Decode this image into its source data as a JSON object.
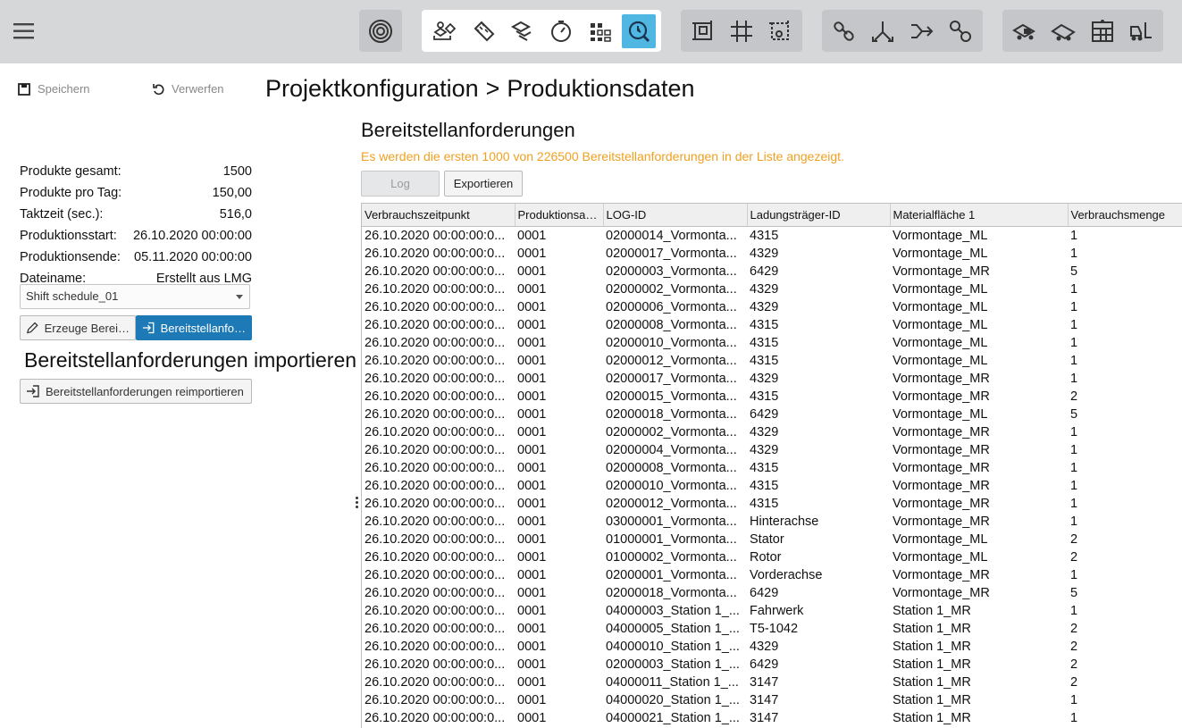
{
  "toolbar": {
    "menu_icon": "hamburger-icon",
    "groups": [
      {
        "buttons": [
          "radar-icon"
        ]
      },
      {
        "buttons": [
          "parts-icon",
          "ruler-icon",
          "layers-icon",
          "stopwatch-icon",
          "matrix-icon",
          "schedule-search-icon"
        ],
        "active": "schedule-search-icon"
      },
      {
        "buttons": [
          "frame-icon",
          "grid-icon",
          "area-icon"
        ]
      },
      {
        "buttons": [
          "chain-icon",
          "split-icon",
          "merge-icon",
          "link-icon"
        ]
      },
      {
        "buttons": [
          "truck-loading-icon",
          "truck-unloading-icon",
          "shelf-icon",
          "forklift-icon"
        ]
      }
    ]
  },
  "actions": {
    "save_label": "Speichern",
    "discard_label": "Verwerfen"
  },
  "breadcrumb": {
    "parent": "Projektkonfiguration",
    "separator": ">",
    "current": "Produktionsdaten"
  },
  "stats": [
    {
      "label": "Produkte gesamt:",
      "value": "1500"
    },
    {
      "label": "Produkte pro Tag:",
      "value": "150,00"
    },
    {
      "label": "Taktzeit (sec.):",
      "value": "516,0"
    },
    {
      "label": "Produktionsstart:",
      "value": "26.10.2020 00:00:00"
    },
    {
      "label": "Produktionsende:",
      "value": "05.11.2020 00:00:00"
    },
    {
      "label": "Dateiname:",
      "value": "Erstellt aus LMG"
    }
  ],
  "schedule": {
    "selected": "Shift schedule_01"
  },
  "buttons": {
    "create_label": "Erzeuge Berei…",
    "import_label": "Bereitstellanfo…",
    "reimport_label": "Bereitstellanforderungen reimportieren",
    "log_label": "Log",
    "export_label": "Exportieren"
  },
  "import_heading": "Bereitstellanforderungen importieren",
  "section": {
    "title": "Bereitstellanforderungen",
    "warning": "Es werden die ersten 1000 von 226500 Bereitstellanforderungen in der Liste angezeigt."
  },
  "table": {
    "columns": [
      "Verbrauchszeitpunkt",
      "Produktionsau...",
      "LOG-ID",
      "Ladungsträger-ID",
      "Materialfläche 1",
      "Verbrauchsmenge"
    ],
    "rows": [
      [
        "26.10.2020 00:00:00:0...",
        "0001",
        "02000014_Vormonta...",
        "4315",
        "Vormontage_ML",
        "1"
      ],
      [
        "26.10.2020 00:00:00:0...",
        "0001",
        "02000017_Vormonta...",
        "4329",
        "Vormontage_ML",
        "1"
      ],
      [
        "26.10.2020 00:00:00:0...",
        "0001",
        "02000003_Vormonta...",
        "6429",
        "Vormontage_MR",
        "5"
      ],
      [
        "26.10.2020 00:00:00:0...",
        "0001",
        "02000002_Vormonta...",
        "4329",
        "Vormontage_ML",
        "1"
      ],
      [
        "26.10.2020 00:00:00:0...",
        "0001",
        "02000006_Vormonta...",
        "4329",
        "Vormontage_ML",
        "1"
      ],
      [
        "26.10.2020 00:00:00:0...",
        "0001",
        "02000008_Vormonta...",
        "4315",
        "Vormontage_ML",
        "1"
      ],
      [
        "26.10.2020 00:00:00:0...",
        "0001",
        "02000010_Vormonta...",
        "4315",
        "Vormontage_ML",
        "1"
      ],
      [
        "26.10.2020 00:00:00:0...",
        "0001",
        "02000012_Vormonta...",
        "4315",
        "Vormontage_ML",
        "1"
      ],
      [
        "26.10.2020 00:00:00:0...",
        "0001",
        "02000017_Vormonta...",
        "4329",
        "Vormontage_MR",
        "1"
      ],
      [
        "26.10.2020 00:00:00:0...",
        "0001",
        "02000015_Vormonta...",
        "4315",
        "Vormontage_MR",
        "2"
      ],
      [
        "26.10.2020 00:00:00:0...",
        "0001",
        "02000018_Vormonta...",
        "6429",
        "Vormontage_ML",
        "5"
      ],
      [
        "26.10.2020 00:00:00:0...",
        "0001",
        "02000002_Vormonta...",
        "4329",
        "Vormontage_MR",
        "1"
      ],
      [
        "26.10.2020 00:00:00:0...",
        "0001",
        "02000004_Vormonta...",
        "4329",
        "Vormontage_MR",
        "1"
      ],
      [
        "26.10.2020 00:00:00:0...",
        "0001",
        "02000008_Vormonta...",
        "4315",
        "Vormontage_MR",
        "1"
      ],
      [
        "26.10.2020 00:00:00:0...",
        "0001",
        "02000010_Vormonta...",
        "4315",
        "Vormontage_MR",
        "1"
      ],
      [
        "26.10.2020 00:00:00:0...",
        "0001",
        "02000012_Vormonta...",
        "4315",
        "Vormontage_MR",
        "1"
      ],
      [
        "26.10.2020 00:00:00:0...",
        "0001",
        "03000001_Vormonta...",
        "Hinterachse",
        "Vormontage_MR",
        "1"
      ],
      [
        "26.10.2020 00:00:00:0...",
        "0001",
        "01000001_Vormonta...",
        "Stator",
        "Vormontage_ML",
        "2"
      ],
      [
        "26.10.2020 00:00:00:0...",
        "0001",
        "01000002_Vormonta...",
        "Rotor",
        "Vormontage_ML",
        "2"
      ],
      [
        "26.10.2020 00:00:00:0...",
        "0001",
        "02000001_Vormonta...",
        "Vorderachse",
        "Vormontage_MR",
        "1"
      ],
      [
        "26.10.2020 00:00:00:0...",
        "0001",
        "02000018_Vormonta...",
        "6429",
        "Vormontage_MR",
        "5"
      ],
      [
        "26.10.2020 00:00:00:0...",
        "0001",
        "04000003_Station 1_...",
        "Fahrwerk",
        "Station 1_MR",
        "1"
      ],
      [
        "26.10.2020 00:00:00:0...",
        "0001",
        "04000005_Station 1_...",
        "T5-1042",
        "Station 1_MR",
        "2"
      ],
      [
        "26.10.2020 00:00:00:0...",
        "0001",
        "04000010_Station 1_...",
        "4329",
        "Station 1_MR",
        "2"
      ],
      [
        "26.10.2020 00:00:00:0...",
        "0001",
        "02000003_Station 1_...",
        "6429",
        "Station 1_MR",
        "2"
      ],
      [
        "26.10.2020 00:00:00:0...",
        "0001",
        "04000011_Station 1_...",
        "3147",
        "Station 1_MR",
        "2"
      ],
      [
        "26.10.2020 00:00:00:0...",
        "0001",
        "04000020_Station 1_...",
        "3147",
        "Station 1_MR",
        "1"
      ],
      [
        "26.10.2020 00:00:00:0...",
        "0001",
        "04000021_Station 1_...",
        "3147",
        "Station 1_MR",
        "1"
      ]
    ]
  },
  "colors": {
    "topbar": "#d6d7d9",
    "active_tool": "#4fb7e2",
    "primary_button": "#1d7ab6",
    "warning_text": "#f0a020"
  }
}
